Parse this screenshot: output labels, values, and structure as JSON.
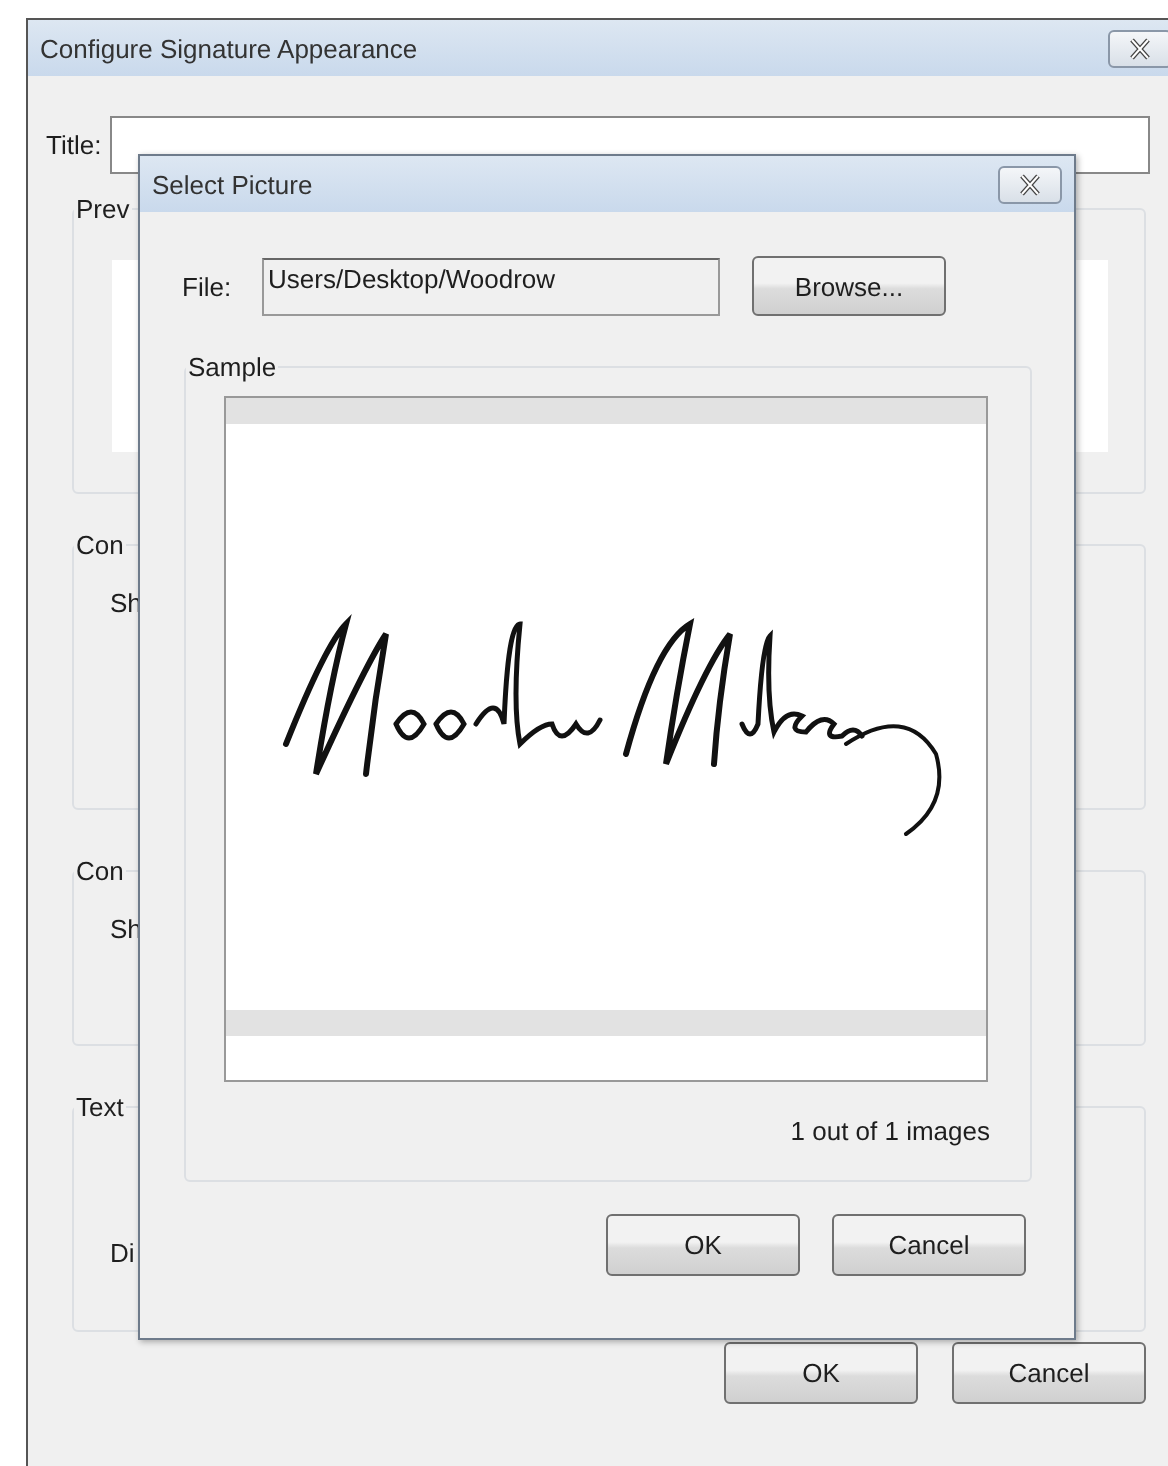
{
  "window": {
    "title": "Configure Signature Appearance"
  },
  "title_field": {
    "label": "Title:"
  },
  "groups": [
    {
      "legend": "Prev"
    },
    {
      "legend": "Con",
      "label": "Sh"
    },
    {
      "legend": "Con",
      "label": "Sh"
    },
    {
      "legend": "Text",
      "label": "Di"
    }
  ],
  "buttons": [
    "OK",
    "Cancel"
  ],
  "dialog": {
    "title": "Select Picture",
    "file_label": "File:",
    "file_value": "Users/Desktop/Woodrow",
    "browse": "Browse...",
    "sample_legend": "Sample",
    "count": "1 out of 1 images",
    "buttons": [
      "OK",
      "Cancel"
    ]
  }
}
